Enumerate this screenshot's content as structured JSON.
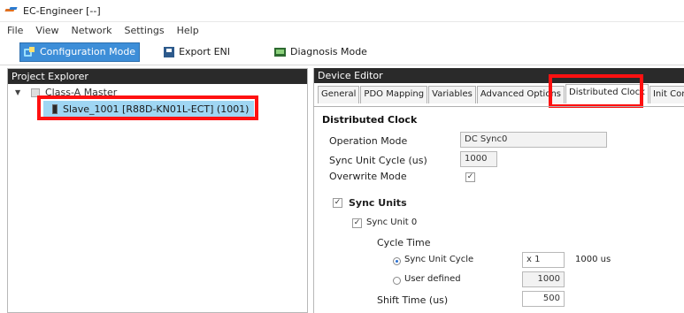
{
  "window": {
    "title": "EC-Engineer [--]"
  },
  "menu": [
    "File",
    "View",
    "Network",
    "Settings",
    "Help"
  ],
  "toolbar": {
    "configuration_mode": "Configuration Mode",
    "export_eni": "Export ENI",
    "diagnosis_mode": "Diagnosis Mode"
  },
  "project_explorer": {
    "header": "Project Explorer",
    "root_label": "Class-A Master",
    "child_label": "Slave_1001 [R88D-KN01L-ECT] (1001)"
  },
  "device_editor": {
    "header": "Device Editor",
    "tabs": [
      "General",
      "PDO Mapping",
      "Variables",
      "Advanced Options",
      "Distributed Clock",
      "Init Com"
    ],
    "selected_tab": "Distributed Clock",
    "section_title": "Distributed Clock",
    "operation_mode_label": "Operation Mode",
    "operation_mode_value": "DC Sync0",
    "sync_unit_cycle_label": "Sync Unit Cycle (us)",
    "sync_unit_cycle_value": "1000",
    "overwrite_mode_label": "Overwrite Mode",
    "sync_units_label": "Sync Units",
    "sync_unit0_label": "Sync Unit 0",
    "cycle_time_label": "Cycle Time",
    "sync_unit_cycle_radio": "Sync Unit Cycle",
    "multiplier_value": "x 1",
    "cycle_us_text": "1000 us",
    "user_defined_label": "User defined",
    "user_defined_value": "1000",
    "shift_time_label": "Shift Time (us)",
    "shift_time_value": "500",
    "checkmark": "✓"
  }
}
